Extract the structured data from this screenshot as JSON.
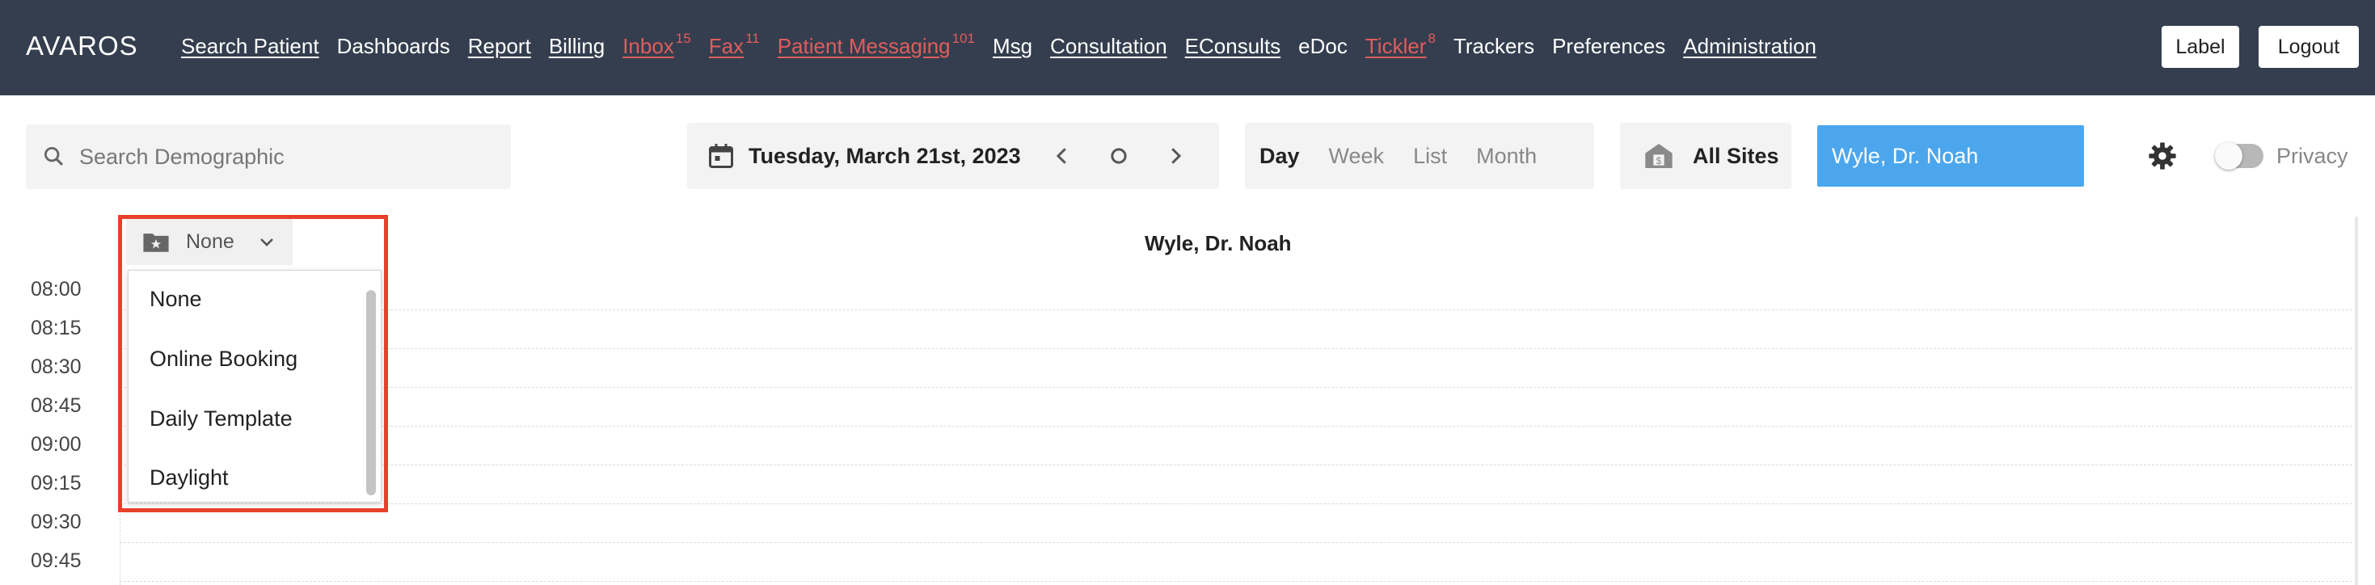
{
  "nav": {
    "brand": "AVAROS",
    "links": [
      {
        "label": "Search Patient",
        "badge": "",
        "alert": false,
        "underline": true
      },
      {
        "label": "Dashboards",
        "badge": "",
        "alert": false,
        "underline": false
      },
      {
        "label": "Report",
        "badge": "",
        "alert": false,
        "underline": true
      },
      {
        "label": "Billing",
        "badge": "",
        "alert": false,
        "underline": true
      },
      {
        "label": "Inbox",
        "badge": "15",
        "alert": true,
        "underline": true
      },
      {
        "label": "Fax",
        "badge": "11",
        "alert": true,
        "underline": true
      },
      {
        "label": "Patient Messaging",
        "badge": "101",
        "alert": true,
        "underline": true
      },
      {
        "label": "Msg",
        "badge": "",
        "alert": false,
        "underline": true
      },
      {
        "label": "Consultation",
        "badge": "",
        "alert": false,
        "underline": true
      },
      {
        "label": "EConsults",
        "badge": "",
        "alert": false,
        "underline": true
      },
      {
        "label": "eDoc",
        "badge": "",
        "alert": false,
        "underline": false
      },
      {
        "label": "Tickler",
        "badge": "8",
        "alert": true,
        "underline": true
      },
      {
        "label": "Trackers",
        "badge": "",
        "alert": false,
        "underline": false
      },
      {
        "label": "Preferences",
        "badge": "",
        "alert": false,
        "underline": false
      },
      {
        "label": "Administration",
        "badge": "",
        "alert": false,
        "underline": true
      }
    ],
    "label_button": "Label",
    "logout_button": "Logout"
  },
  "toolbar": {
    "search_placeholder": "Search Demographic",
    "date": "Tuesday, March 21st, 2023",
    "views": [
      "Day",
      "Week",
      "List",
      "Month"
    ],
    "active_view": "Day",
    "sites": "All Sites",
    "provider": "Wyle, Dr. Noah",
    "privacy_label": "Privacy",
    "privacy_on": false
  },
  "schedule": {
    "provider_header": "Wyle, Dr. Noah",
    "times": [
      "08:00",
      "08:15",
      "08:30",
      "08:45",
      "09:00",
      "09:15",
      "09:30",
      "09:45"
    ]
  },
  "template_dropdown": {
    "selected": "None",
    "options": [
      "None",
      "Online Booking",
      "Daily Template",
      "Daylight"
    ]
  },
  "colors": {
    "nav_bg": "#343e4e",
    "alert": "#e05d5d",
    "provider_bg": "#4ba6ed",
    "highlight": "#e8402a"
  }
}
